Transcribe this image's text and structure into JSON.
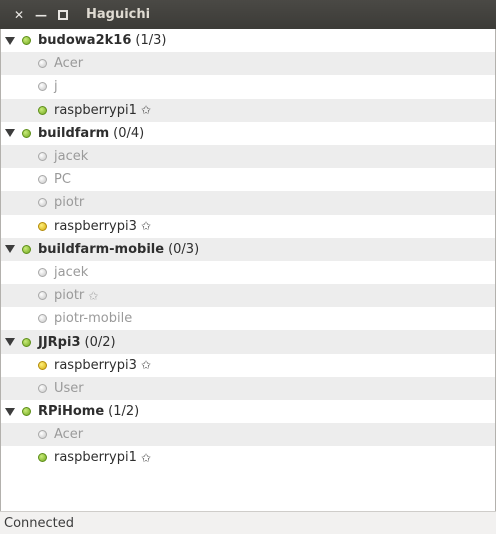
{
  "window": {
    "title": "Haguichi"
  },
  "status": "Connected",
  "colors": {
    "titlebar": "#3c3b37",
    "online": "#73a81f",
    "away": "#d6ad10",
    "offline": "#c6c6c6"
  },
  "groups": [
    {
      "name": "budowa2k16",
      "count": "(1/3)",
      "status": "online",
      "members": [
        {
          "name": "Acer",
          "status": "offline",
          "star": ""
        },
        {
          "name": "j",
          "status": "offline",
          "star": ""
        },
        {
          "name": "raspberrypi1",
          "status": "online",
          "star": "✩"
        }
      ]
    },
    {
      "name": "buildfarm",
      "count": "(0/4)",
      "status": "online",
      "members": [
        {
          "name": "jacek",
          "status": "offline",
          "star": ""
        },
        {
          "name": "PC",
          "status": "offline",
          "star": ""
        },
        {
          "name": "piotr",
          "status": "offline",
          "star": ""
        },
        {
          "name": "raspberrypi3",
          "status": "away",
          "star": "✩"
        }
      ]
    },
    {
      "name": "buildfarm-mobile",
      "count": "(0/3)",
      "status": "online",
      "members": [
        {
          "name": "jacek",
          "status": "offline",
          "star": ""
        },
        {
          "name": "piotr",
          "status": "offline",
          "star": "✩"
        },
        {
          "name": "piotr-mobile",
          "status": "offline",
          "star": ""
        }
      ]
    },
    {
      "name": "JJRpi3",
      "count": "(0/2)",
      "status": "online",
      "members": [
        {
          "name": "raspberrypi3",
          "status": "away",
          "star": "✩"
        },
        {
          "name": "User",
          "status": "offline",
          "star": ""
        }
      ]
    },
    {
      "name": "RPiHome",
      "count": "(1/2)",
      "status": "online",
      "members": [
        {
          "name": "Acer",
          "status": "offline",
          "star": ""
        },
        {
          "name": "raspberrypi1",
          "status": "online",
          "star": "✩"
        }
      ]
    }
  ]
}
